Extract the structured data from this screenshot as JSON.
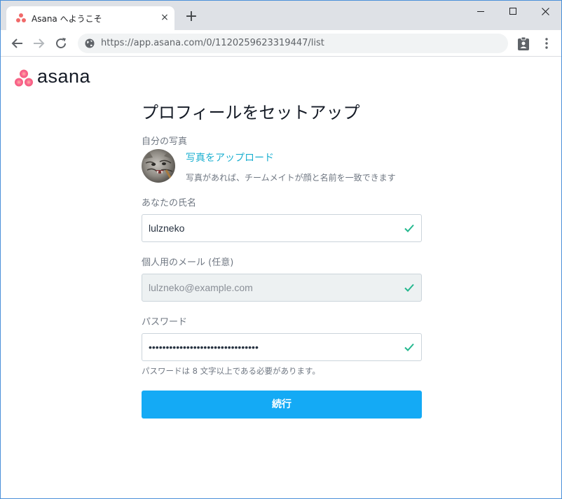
{
  "browser": {
    "tab_title": "Asana へようこそ",
    "tab_close": "×",
    "new_tab": "+",
    "url": "https://app.asana.com/0/1120259623319447/list"
  },
  "logo": {
    "text": "asana"
  },
  "form": {
    "heading": "プロフィールをセットアップ",
    "photo_label": "自分の写真",
    "upload_link": "写真をアップロード",
    "upload_help": "写真があれば、チームメイトが顔と名前を一致できます",
    "name_label": "あなたの氏名",
    "name_value": "lulzneko",
    "email_label": "個人用のメール (任意)",
    "email_value": "lulzneko@example.com",
    "password_label": "パスワード",
    "password_value": "••••••••••••••••••••••••••••••••",
    "password_hint": "パスワードは 8 文字以上である必要があります。",
    "continue_label": "続行"
  },
  "colors": {
    "accent": "#14aaf5",
    "link": "#1aafd0",
    "check": "#25b88f",
    "brand_dot": "#f06a6a"
  }
}
